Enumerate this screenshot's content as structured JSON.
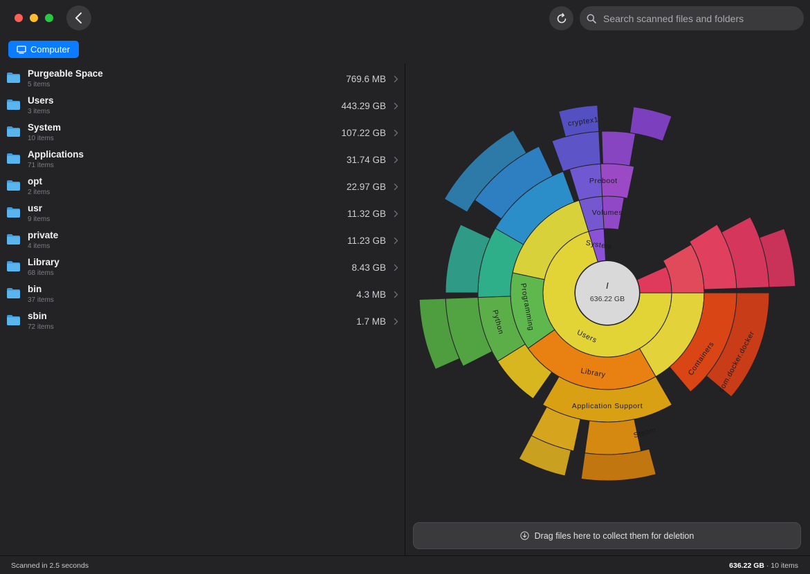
{
  "toolbar": {
    "search_placeholder": "Search scanned files and folders"
  },
  "breadcrumb": {
    "label": "Computer"
  },
  "items": [
    {
      "name": "Purgeable Space",
      "count": "5 items",
      "size": "769.6 MB"
    },
    {
      "name": "Users",
      "count": "3 items",
      "size": "443.29 GB"
    },
    {
      "name": "System",
      "count": "10 items",
      "size": "107.22 GB"
    },
    {
      "name": "Applications",
      "count": "71 items",
      "size": "31.74 GB"
    },
    {
      "name": "opt",
      "count": "2 items",
      "size": "22.97 GB"
    },
    {
      "name": "usr",
      "count": "9 items",
      "size": "11.32 GB"
    },
    {
      "name": "private",
      "count": "4 items",
      "size": "11.23 GB"
    },
    {
      "name": "Library",
      "count": "68 items",
      "size": "8.43 GB"
    },
    {
      "name": "bin",
      "count": "37 items",
      "size": "4.3 MB"
    },
    {
      "name": "sbin",
      "count": "72 items",
      "size": "1.7 MB"
    }
  ],
  "sunburst": {
    "center_label": "/",
    "center_size": "636.22 GB",
    "labels": {
      "users": "Users",
      "library": "Library",
      "application_support": "Application Support",
      "steam": "Steam",
      "containers": "Containers",
      "docker": "com.docker.docker",
      "programming": "Programming",
      "python": "Python",
      "system": "System",
      "volumes": "Volumes",
      "preboot": "Preboot",
      "cryptex": "cryptex1"
    }
  },
  "dropzone": {
    "label": "Drag files here to collect them for deletion"
  },
  "status": {
    "scan_time": "Scanned in 2.5 seconds",
    "total": "636.22 GB",
    "count": "· 10 items"
  },
  "colors": {
    "accent": "#0a7cff",
    "folder": "#5ab4ee"
  }
}
